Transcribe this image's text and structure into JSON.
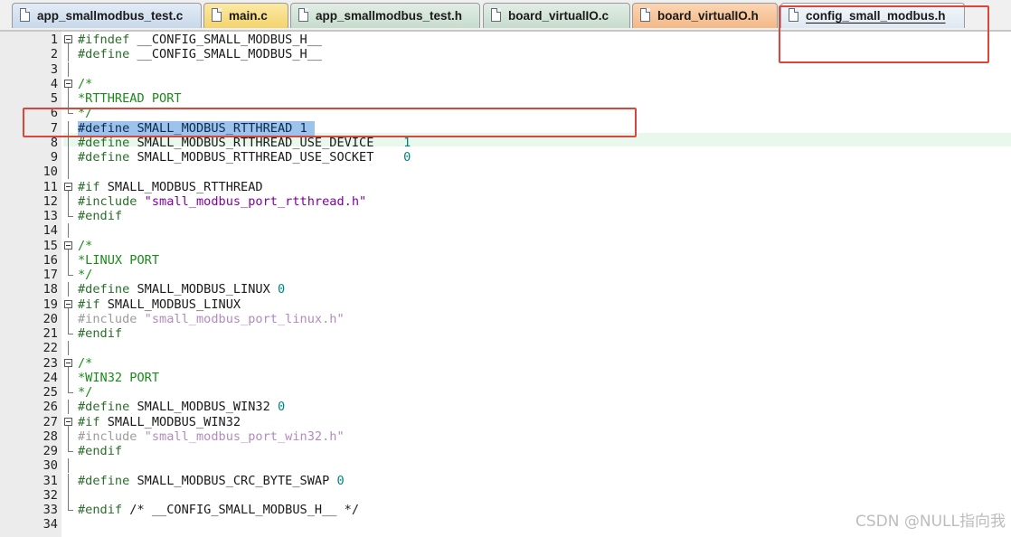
{
  "tabs": [
    {
      "label": "app_smallmodbus_test.c"
    },
    {
      "label": "main.c"
    },
    {
      "label": "app_smallmodbus_test.h"
    },
    {
      "label": "board_virtualIO.c"
    },
    {
      "label": "board_virtualIO.h"
    },
    {
      "label": "config_small_modbus.h"
    }
  ],
  "active_tab": "config_small_modbus.h",
  "lines": [
    {
      "n": "1",
      "a": "#ifndef",
      "b": " __CONFIG_SMALL_MODBUS_H__"
    },
    {
      "n": "2",
      "a": "#define",
      "b": " __CONFIG_SMALL_MODBUS_H__"
    },
    {
      "n": "3"
    },
    {
      "n": "4",
      "c": "/*"
    },
    {
      "n": "5",
      "c": "*RTTHREAD PORT"
    },
    {
      "n": "6",
      "c": "*/"
    },
    {
      "n": "7",
      "sel": "#define SMALL_MODBUS_RTTHREAD 1 "
    },
    {
      "n": "8",
      "a": "#define",
      "b": " SMALL_MODBUS_RTTHREAD_USE_DEVICE    ",
      "v": "1"
    },
    {
      "n": "9",
      "a": "#define",
      "b": " SMALL_MODBUS_RTTHREAD_USE_SOCKET    ",
      "v": "0"
    },
    {
      "n": "10"
    },
    {
      "n": "11",
      "a": "#if",
      "b": " SMALL_MODBUS_RTTHREAD"
    },
    {
      "n": "12",
      "a": "#include",
      "s": " \"small_modbus_port_rtthread.h\""
    },
    {
      "n": "13",
      "a": "#endif"
    },
    {
      "n": "14"
    },
    {
      "n": "15",
      "c": "/*"
    },
    {
      "n": "16",
      "c": "*LINUX PORT"
    },
    {
      "n": "17",
      "c": "*/"
    },
    {
      "n": "18",
      "a": "#define",
      "b": " SMALL_MODBUS_LINUX ",
      "v": "0"
    },
    {
      "n": "19",
      "a": "#if",
      "b": " SMALL_MODBUS_LINUX"
    },
    {
      "n": "20",
      "da": "#include",
      "ds": " \"small_modbus_port_linux.h\""
    },
    {
      "n": "21",
      "a": "#endif"
    },
    {
      "n": "22"
    },
    {
      "n": "23",
      "c": "/*"
    },
    {
      "n": "24",
      "c": "*WIN32 PORT"
    },
    {
      "n": "25",
      "c": "*/"
    },
    {
      "n": "26",
      "a": "#define",
      "b": " SMALL_MODBUS_WIN32 ",
      "v": "0"
    },
    {
      "n": "27",
      "a": "#if",
      "b": " SMALL_MODBUS_WIN32"
    },
    {
      "n": "28",
      "da": "#include",
      "ds": " \"small_modbus_port_win32.h\""
    },
    {
      "n": "29",
      "a": "#endif"
    },
    {
      "n": "30"
    },
    {
      "n": "31",
      "a": "#define",
      "b": " SMALL_MODBUS_CRC_BYTE_SWAP ",
      "v": "0"
    },
    {
      "n": "32"
    },
    {
      "n": "33",
      "a": "#endif",
      "b": " /* __CONFIG_SMALL_MODBUS_H__ */"
    },
    {
      "n": "34"
    }
  ],
  "watermark": "CSDN @NULL指向我",
  "colors": {
    "highlight_box": "#d9463c",
    "selection": "#9dc3ec",
    "current_line": "#e9f8ec"
  }
}
